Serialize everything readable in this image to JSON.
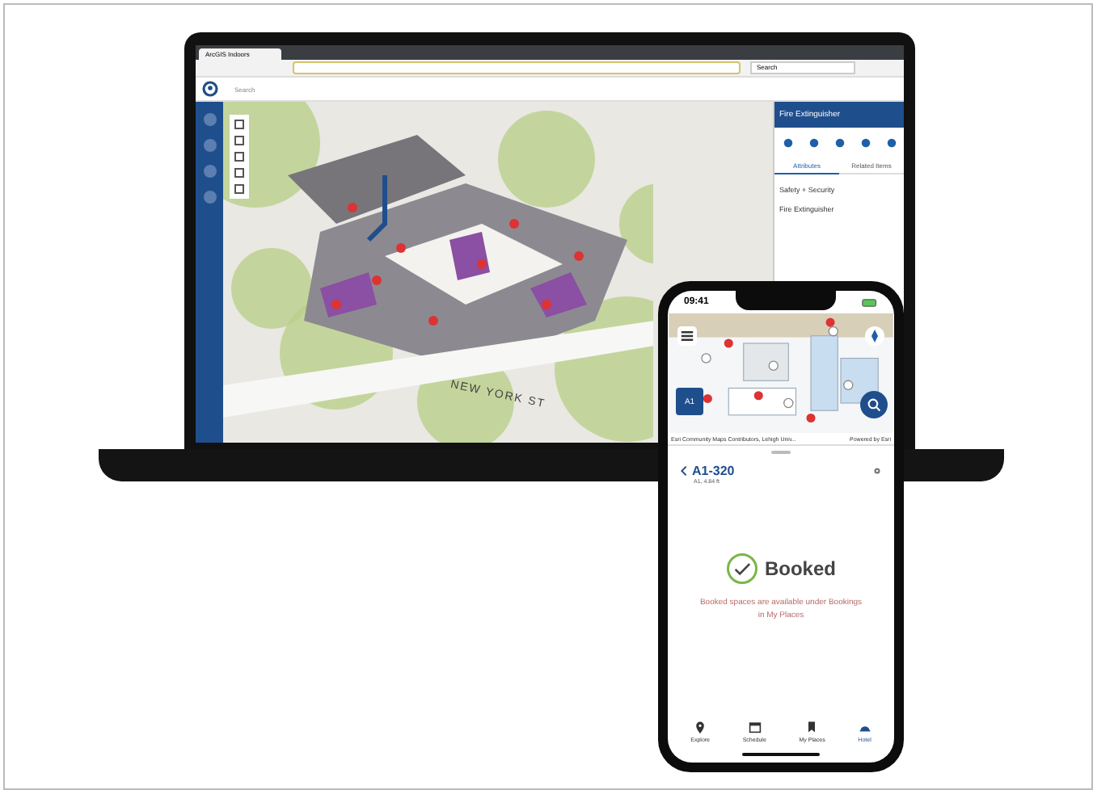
{
  "laptop": {
    "browser": {
      "tab_title": "ArcGIS Indoors",
      "search_placeholder": "Search"
    },
    "app": {
      "search_placeholder": "Search",
      "street_label": "NEW YORK ST",
      "panel": {
        "title": "Fire Extinguisher",
        "tabs": [
          {
            "label": "Attributes",
            "selected": true
          },
          {
            "label": "Related Items",
            "selected": false
          }
        ],
        "fields": [
          {
            "value": "Safety + Security"
          },
          {
            "value": "Fire Extinguisher"
          }
        ]
      }
    }
  },
  "phone": {
    "status_bar": {
      "time": "09:41"
    },
    "map": {
      "floor": "A1",
      "attribution": "Esri Community Maps Contributors, Lehigh Univ...",
      "powered_by": "Powered by Esri"
    },
    "sheet": {
      "title": "A1-320",
      "subtitle": "A1, 4.84 ft",
      "status": "Booked",
      "message": "Booked spaces are available under Bookings in My Places"
    },
    "nav": [
      {
        "label": "Explore",
        "selected": false
      },
      {
        "label": "Schedule",
        "selected": false
      },
      {
        "label": "My Places",
        "selected": false
      },
      {
        "label": "Hotel",
        "selected": true
      }
    ]
  }
}
